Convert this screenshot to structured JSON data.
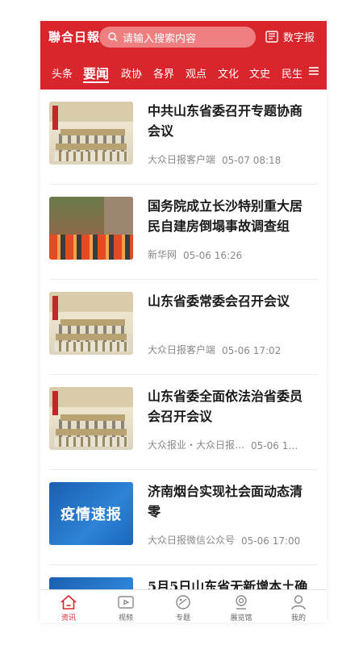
{
  "header": {
    "logo": "聯合日報",
    "search_placeholder": "请输入搜索内容",
    "digital_paper_label": "数字报"
  },
  "tabs": [
    "头条",
    "要闻",
    "政协",
    "各界",
    "观点",
    "文化",
    "文史",
    "民生"
  ],
  "active_tab": "要闻",
  "colors": {
    "brand": "#d8262c",
    "text_primary": "#1a1a1a",
    "text_meta": "#888888"
  },
  "articles": [
    {
      "title": "中共山东省委召开专题协商会议",
      "source": "大众日报客户端",
      "time": "05-07 08:18",
      "thumb": "meeting-photo"
    },
    {
      "title": "国务院成立长沙特别重大居民自建房倒塌事故调查组",
      "source": "新华网",
      "time": "05-06 16:26",
      "thumb": "rescue-photo"
    },
    {
      "title": "山东省委常委会召开会议",
      "source": "大众日报客户端",
      "time": "05-06 17:02",
      "thumb": "meeting-photo"
    },
    {
      "title": "山东省委全面依法治省委员会召开会议",
      "source": "大众报业・大众日报…",
      "time": "05-06 1…",
      "thumb": "meeting-photo"
    },
    {
      "title": "济南烟台实现社会面动态清零",
      "source": "大众日报微信公众号",
      "time": "05-06 17:00",
      "thumb": "yiqing-banner",
      "thumb_text": "疫情速报"
    },
    {
      "title": "5月5日山东省无新增本土确",
      "source": "",
      "time": "",
      "thumb": "yiqing-banner"
    }
  ],
  "bottom_nav": [
    {
      "label": "资讯",
      "icon": "home-icon",
      "active": true
    },
    {
      "label": "视频",
      "icon": "video-icon",
      "active": false
    },
    {
      "label": "专题",
      "icon": "topic-icon",
      "active": false
    },
    {
      "label": "展览馆",
      "icon": "exhibition-icon",
      "active": false
    },
    {
      "label": "我的",
      "icon": "profile-icon",
      "active": false
    }
  ]
}
